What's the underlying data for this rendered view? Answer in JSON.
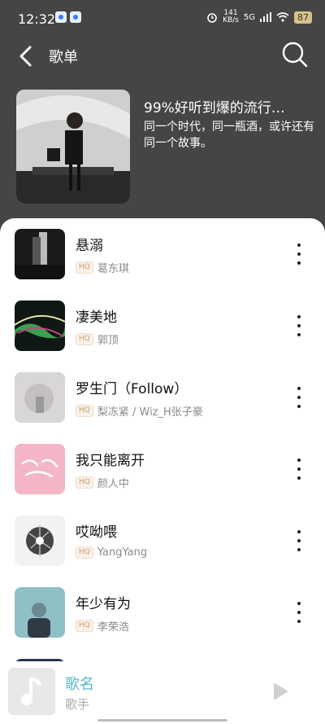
{
  "status_bar": {
    "time": "12:32",
    "net_speed": "141",
    "net_unit": "KB/s",
    "signal": "5G",
    "battery": "87"
  },
  "header": {
    "title": "歌单",
    "back_icon": "chevron-left-icon",
    "search_icon": "search-icon"
  },
  "playlist": {
    "title": "99%好听到爆的流行…",
    "description": "同一个时代，同一瓶酒，或许还有同一个故事。"
  },
  "songs": [
    {
      "title": "悬溺",
      "quality": "HQ",
      "artist": "葛东琪"
    },
    {
      "title": "凄美地",
      "quality": "HQ",
      "artist": "郭顶"
    },
    {
      "title": "罗生门（Follow）",
      "quality": "HQ",
      "artist": "梨冻紧 / Wiz_H张子豪"
    },
    {
      "title": "我只能离开",
      "quality": "HQ",
      "artist": "颜人中"
    },
    {
      "title": "哎呦喂",
      "quality": "HQ",
      "artist": "YangYang"
    },
    {
      "title": "年少有为",
      "quality": "HQ",
      "artist": "李荣浩"
    }
  ],
  "mini_player": {
    "title": "歌名",
    "artist": "歌手"
  },
  "colors": {
    "header_bg": "#454545",
    "accent": "#58b8c8",
    "hq_badge": "#c59a74"
  }
}
